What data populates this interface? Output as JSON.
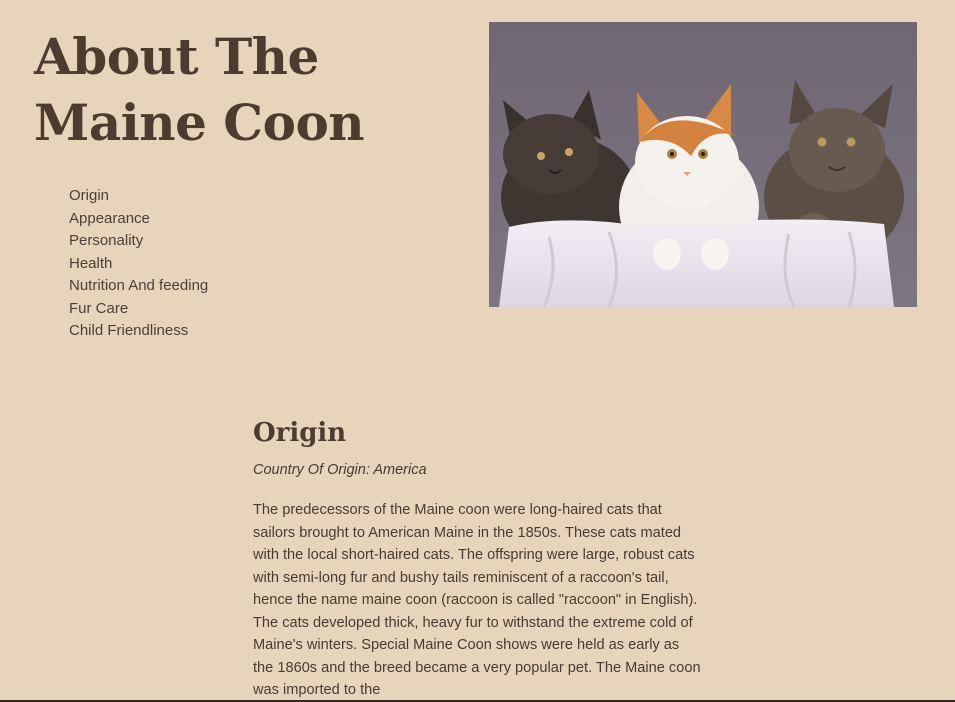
{
  "page": {
    "title": "About The Maine Coon",
    "nav_items": [
      "Origin",
      "Appearance",
      "Personality",
      "Health",
      "Nutrition And feeding",
      "Fur Care",
      "Child Friendliness"
    ],
    "hero_image": "three-maine-coon-kittens-photo"
  },
  "section": {
    "title": "Origin",
    "subtitle": "Country Of Origin: America",
    "body": "The predecessors of the Maine coon were long-haired cats that sailors brought to American Maine in the 1850s. These cats mated with the local short-haired cats. The offspring were large, robust cats with semi-long fur and bushy tails reminiscent of a raccoon's tail, hence the name maine coon (raccoon is called \"raccoon\" in English). The cats developed thick, heavy fur to withstand the extreme cold of Maine's winters. Special Maine Coon shows were held as early as the 1860s and the breed became a very popular pet. The Maine coon was imported to the"
  },
  "colors": {
    "background": "#e8d4bb",
    "text": "#4a3a2f",
    "heading": "#4e3a2e"
  }
}
